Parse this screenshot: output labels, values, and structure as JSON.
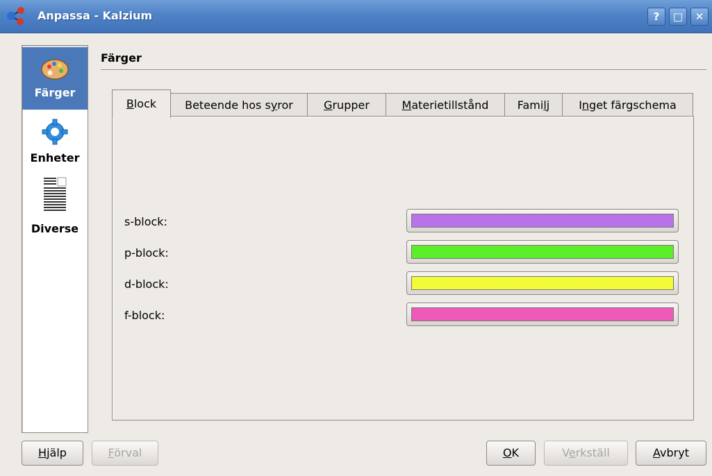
{
  "window": {
    "title": "Anpassa - Kalzium",
    "buttons": {
      "help": "?",
      "maximize": "□",
      "close": "✕"
    }
  },
  "sidebar": {
    "items": [
      {
        "label": "Färger",
        "icon": "palette-icon",
        "selected": true
      },
      {
        "label": "Enheter",
        "icon": "gear-icon",
        "selected": false
      },
      {
        "label": "Diverse",
        "icon": "document-lines-icon",
        "selected": false
      }
    ]
  },
  "page": {
    "title": "Färger"
  },
  "tabs": [
    {
      "pre": "",
      "key": "B",
      "post": "lock",
      "active": true
    },
    {
      "pre": "Beteende hos s",
      "key": "y",
      "post": "ror",
      "active": false
    },
    {
      "pre": "",
      "key": "G",
      "post": "rupper",
      "active": false
    },
    {
      "pre": "",
      "key": "M",
      "post": "aterietillstånd",
      "active": false
    },
    {
      "pre": "Fami",
      "key": "l",
      "post": "j",
      "active": false
    },
    {
      "pre": "I",
      "key": "n",
      "post": "get färgschema",
      "active": false
    }
  ],
  "colors": {
    "rows": [
      {
        "label": "s-block:",
        "color": "#b873e8"
      },
      {
        "label": "p-block:",
        "color": "#5ded2a"
      },
      {
        "label": "d-block:",
        "color": "#f2fb3a"
      },
      {
        "label": "f-block:",
        "color": "#ee5ab8"
      }
    ]
  },
  "buttons": {
    "help": {
      "key": "H",
      "rest": "jälp"
    },
    "defaults": {
      "key": "F",
      "rest": "örval"
    },
    "ok": {
      "key": "O",
      "rest": "K"
    },
    "apply": {
      "pre": "V",
      "key": "e",
      "rest": "rkställ"
    },
    "cancel": {
      "key": "A",
      "rest": "vbryt"
    }
  },
  "theme": {
    "titlebar": "#4f82c6",
    "selection": "#4a78b8",
    "window_bg": "#eeeae6"
  }
}
